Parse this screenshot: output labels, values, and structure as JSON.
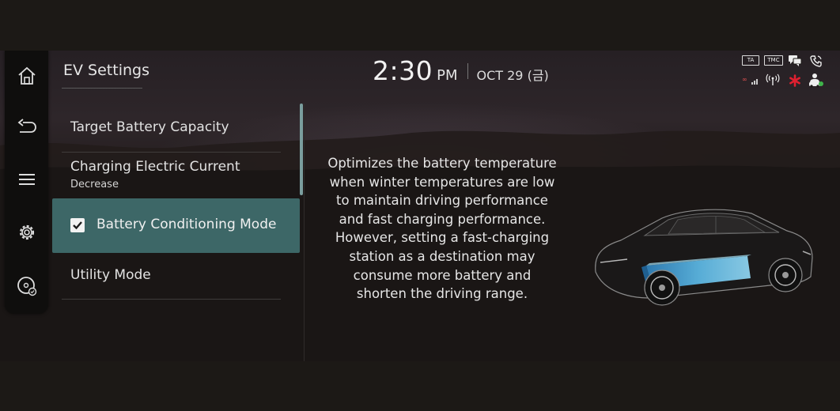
{
  "header": {
    "title": "EV Settings",
    "time": "2:30",
    "ampm": "PM",
    "date": "OCT 29 (금)"
  },
  "status_bar": {
    "icons": [
      "ta-badge",
      "tmc-badge",
      "message-icon",
      "phone-icon",
      "signal-strength-icon",
      "wireless-icon",
      "asterisk-icon",
      "driver-profile-icon"
    ],
    "ta_label": "TA",
    "tmc_label": "TMC",
    "asterisk_color": "#e02030"
  },
  "sidebar": {
    "items": [
      "home-icon",
      "back-icon",
      "menu-icon",
      "settings-gear-icon",
      "disc-media-icon"
    ]
  },
  "menu": {
    "items": [
      {
        "label": "Target Battery Capacity"
      },
      {
        "label": "Charging Electric Current",
        "sub": "Decrease"
      },
      {
        "label": "Battery Conditioning Mode",
        "checked": true,
        "selected": true
      },
      {
        "label": "Utility Mode"
      }
    ]
  },
  "description": {
    "lines": [
      "Optimizes the battery temperature",
      "when winter temperatures are low",
      "to maintain driving performance",
      "and fast charging performance.",
      "However, setting a fast-charging",
      "station as a destination may",
      "consume more battery and",
      "shorten the driving range."
    ]
  },
  "colors": {
    "selected_row": "#3d6767",
    "scrollbar": "#7a9e9e",
    "battery": "#5ab4e0"
  }
}
